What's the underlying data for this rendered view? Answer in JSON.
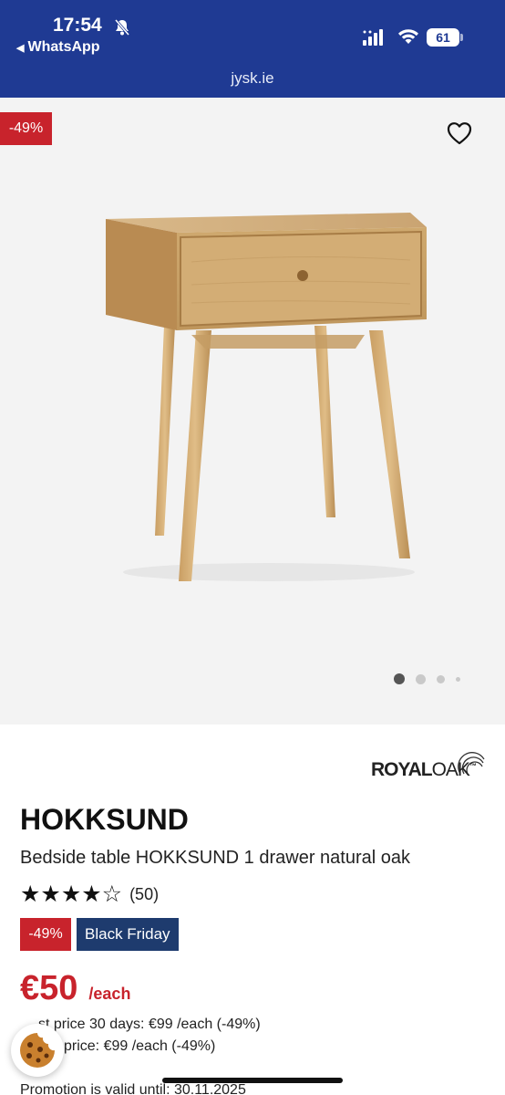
{
  "status_bar": {
    "time": "17:54",
    "back_app": "WhatsApp",
    "battery": "61"
  },
  "browser": {
    "url": "jysk.ie"
  },
  "gallery": {
    "discount_badge": "-49%",
    "dots_count": 4,
    "active_dot": 0
  },
  "product": {
    "brand_bold": "ROYAL",
    "brand_light": "OAK",
    "brand_tm": "™",
    "title": "HOKKSUND",
    "subtitle": "Bedside table HOKKSUND 1 drawer natural oak",
    "stars": "★★★★☆",
    "rating_value": 4,
    "rating_count": "(50)",
    "tag_discount": "-49%",
    "tag_event": "Black Friday",
    "price": "€50",
    "price_unit": "/each",
    "lowest_price_line": "st price 30 days: €99 /each (-49%)",
    "original_price_line": "l price: €99 /each (-49%)",
    "promotion_line": "Promotion is valid until: 30.11.2025"
  },
  "colors": {
    "header_bg": "#1f3a93",
    "sale_red": "#c8232c",
    "black_friday_bg": "#1e3b6e",
    "gallery_bg": "#f3f3f3"
  },
  "icons": {
    "wishlist": "heart-outline-icon",
    "cookie": "cookie-icon",
    "bell": "bell-slash-icon"
  }
}
